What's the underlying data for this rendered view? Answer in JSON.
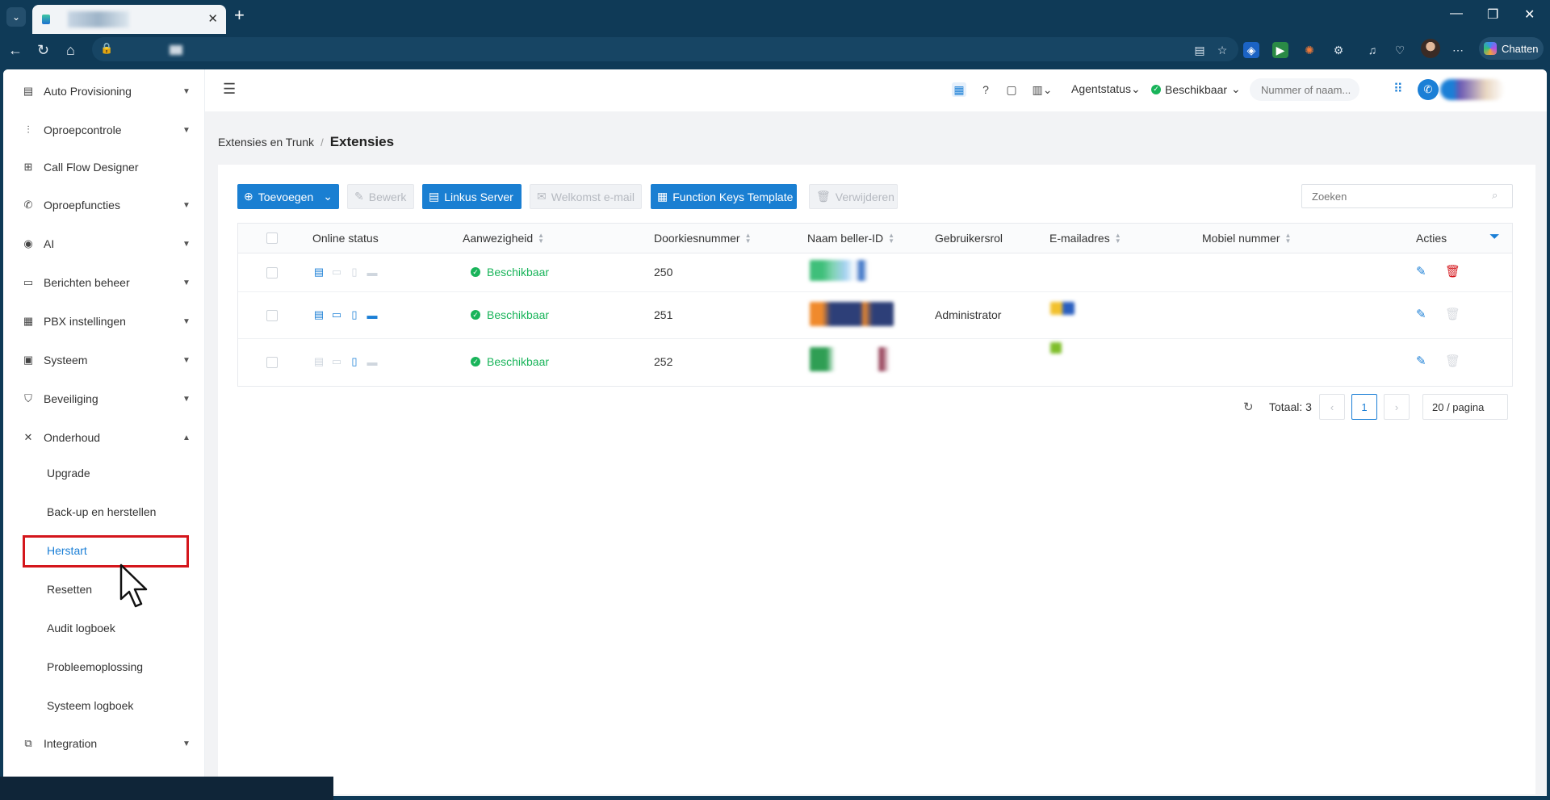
{
  "browser": {
    "tab_close": "✕",
    "new_tab": "+",
    "copilot_label": "Chatten",
    "window_controls": [
      "—",
      "❐",
      "✕"
    ]
  },
  "header": {
    "agent_status_label": "Agentstatus",
    "availability_label": "Beschikbaar",
    "number_placeholder": "Nummer of naam..."
  },
  "sidebar": {
    "items": [
      {
        "label": "Auto Provisioning",
        "icon": "provisioning-icon",
        "chevron": "down"
      },
      {
        "label": "Oproepcontrole",
        "icon": "sliders-icon",
        "chevron": "down"
      },
      {
        "label": "Call Flow Designer",
        "icon": "flow-icon",
        "chevron": ""
      },
      {
        "label": "Oproepfuncties",
        "icon": "phone-settings-icon",
        "chevron": "down"
      },
      {
        "label": "AI",
        "icon": "ai-icon",
        "chevron": "down"
      },
      {
        "label": "Berichten beheer",
        "icon": "message-icon",
        "chevron": "down"
      },
      {
        "label": "PBX instellingen",
        "icon": "pbx-icon",
        "chevron": "down"
      },
      {
        "label": "Systeem",
        "icon": "system-icon",
        "chevron": "down"
      },
      {
        "label": "Beveiliging",
        "icon": "shield-icon",
        "chevron": "down"
      },
      {
        "label": "Onderhoud",
        "icon": "tools-icon",
        "chevron": "up"
      }
    ],
    "sub_items": [
      {
        "label": "Upgrade"
      },
      {
        "label": "Back-up en herstellen"
      },
      {
        "label": "Herstart"
      },
      {
        "label": "Resetten"
      },
      {
        "label": "Audit logboek"
      },
      {
        "label": "Probleemoplossing"
      },
      {
        "label": "Systeem logboek"
      }
    ],
    "bottom_item": {
      "label": "Integration",
      "icon": "integration-icon"
    },
    "active_sub": "Herstart"
  },
  "breadcrumb": {
    "parent": "Extensies en Trunk",
    "separator": "/",
    "current": "Extensies"
  },
  "toolbar": {
    "add_label": "Toevoegen",
    "edit_label": "Bewerk",
    "linkus_label": "Linkus Server",
    "welcome_label": "Welkomst e-mail",
    "fkt_label": "Function Keys Template",
    "delete_label": "Verwijderen",
    "search_placeholder": "Zoeken"
  },
  "table": {
    "columns": [
      "Online status",
      "Aanwezigheid",
      "Doorkiesnummer",
      "Naam beller-ID",
      "Gebruikersrol",
      "E-mailadres",
      "Mobiel nummer",
      "Acties"
    ],
    "rows": [
      {
        "devices": [
          true,
          false,
          false,
          false
        ],
        "presence": "Beschikbaar",
        "extension": "250",
        "role": "",
        "deletable": true
      },
      {
        "devices": [
          true,
          true,
          true,
          true
        ],
        "presence": "Beschikbaar",
        "extension": "251",
        "role": "Administrator",
        "deletable": false
      },
      {
        "devices": [
          false,
          false,
          true,
          false
        ],
        "presence": "Beschikbaar",
        "extension": "252",
        "role": "",
        "deletable": false
      }
    ]
  },
  "pagination": {
    "total_label": "Totaal: 3",
    "current_page": "1",
    "page_size": "20 / pagina"
  },
  "colors": {
    "accent": "#1a7fd2",
    "success": "#19b45a",
    "danger": "#d4161c",
    "browser_chrome": "#0f3a57"
  }
}
